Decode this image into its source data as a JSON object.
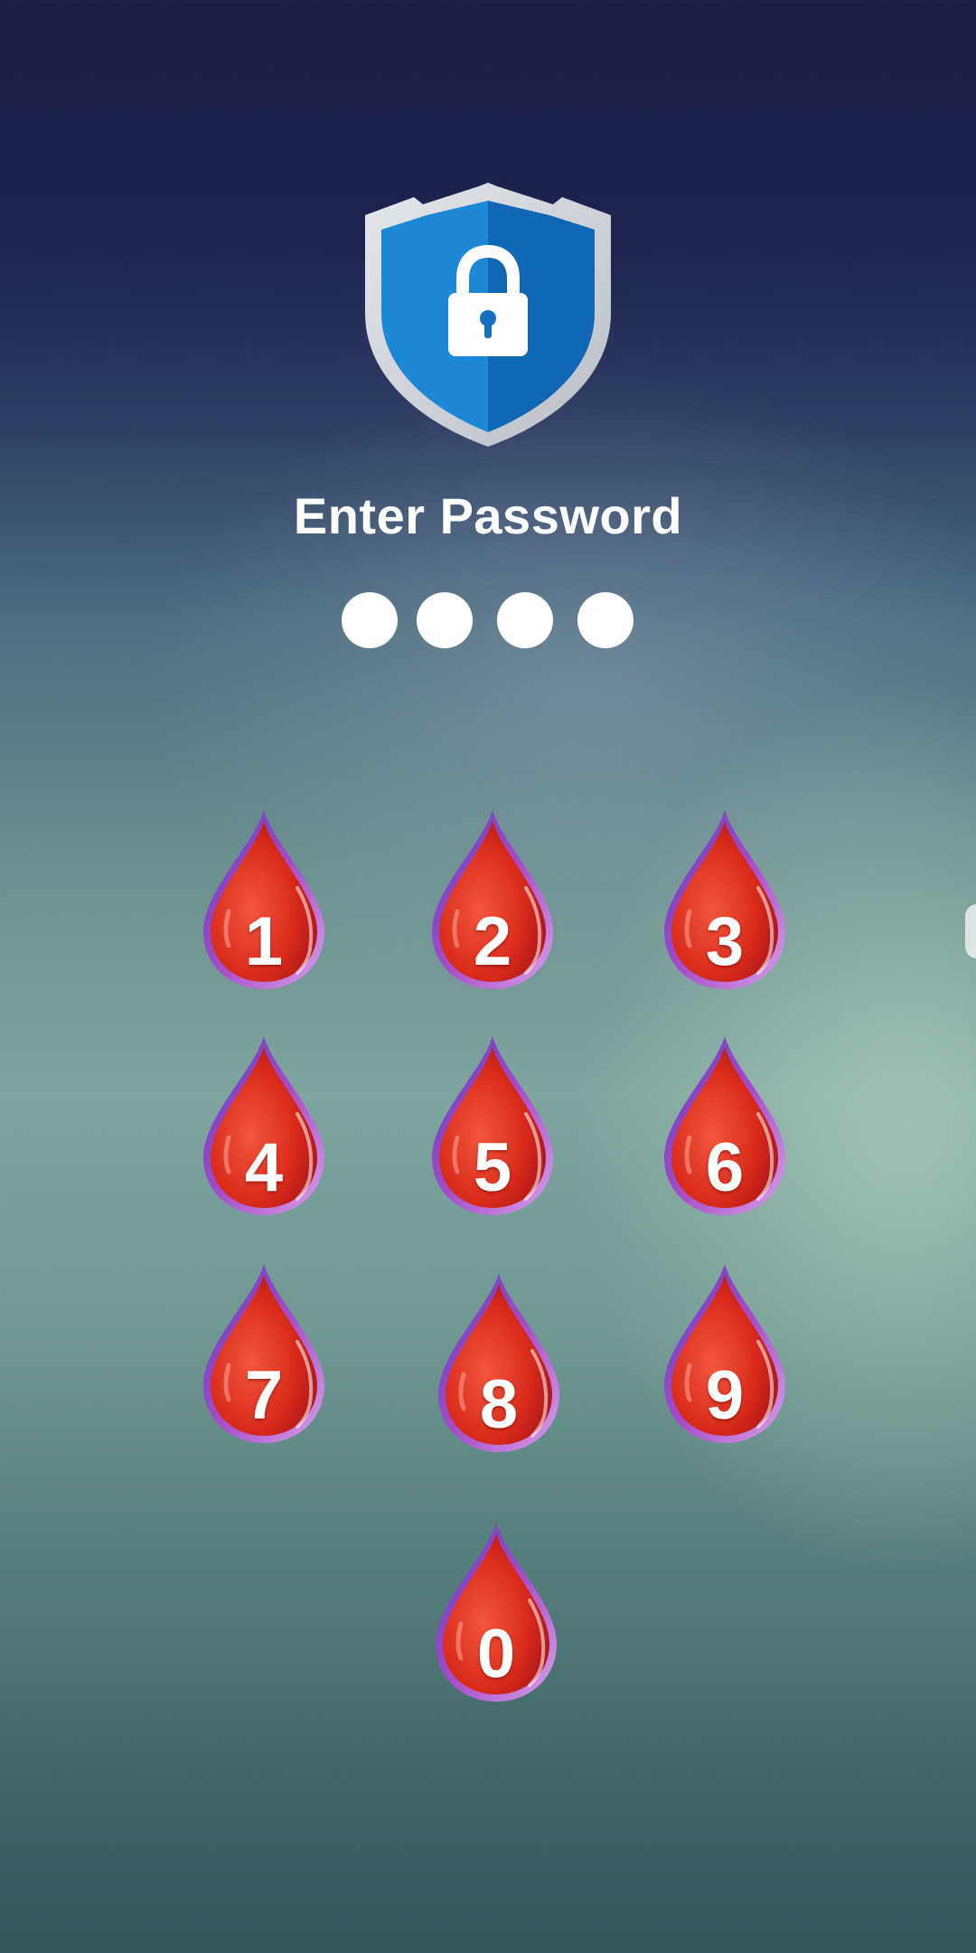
{
  "screen": {
    "title": "Enter Password",
    "pin_dots": [
      true,
      true,
      true,
      true
    ],
    "icons": {
      "shield": "shield-lock-icon",
      "key_shape": "blood-drop-icon"
    },
    "colors": {
      "shield_blue": "#1e88d8",
      "shield_dark_blue": "#0d5fa8",
      "shield_rim": "#d5d9de",
      "drop_red": "#e0321c",
      "drop_rim": "#8a3fb0"
    }
  },
  "keypad": {
    "keys": [
      {
        "label": "1"
      },
      {
        "label": "2"
      },
      {
        "label": "3"
      },
      {
        "label": "4"
      },
      {
        "label": "5"
      },
      {
        "label": "6"
      },
      {
        "label": "7"
      },
      {
        "label": "8"
      },
      {
        "label": "9"
      },
      {
        "label": "0"
      }
    ]
  }
}
